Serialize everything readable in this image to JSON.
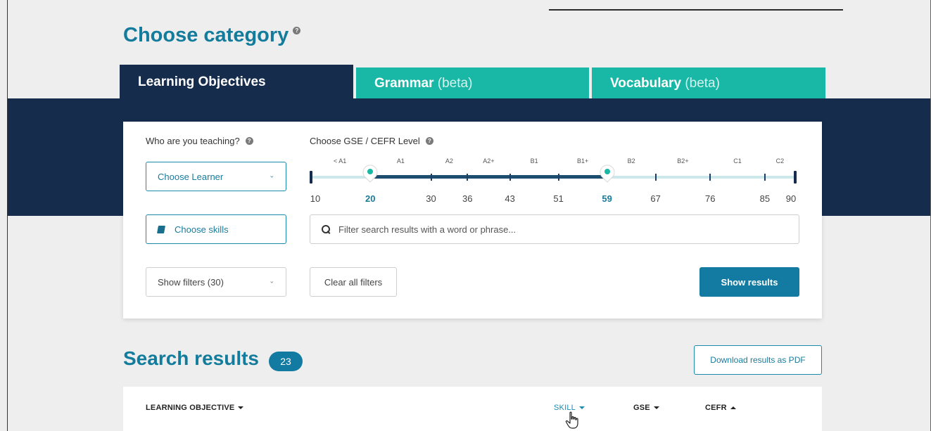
{
  "category": {
    "title": "Choose category",
    "help_icon": "question-circle-icon"
  },
  "tabs": [
    {
      "label": "Learning Objectives",
      "suffix": "",
      "active": true
    },
    {
      "label": "Grammar",
      "suffix": "(beta)",
      "active": false
    },
    {
      "label": "Vocabulary",
      "suffix": "(beta)",
      "active": false
    }
  ],
  "learner": {
    "label": "Who are you teaching?",
    "select_value": "Choose Learner"
  },
  "skills": {
    "button_label": "Choose skills",
    "icon": "book-icon"
  },
  "filters": {
    "select_value": "Show filters (30)",
    "clear_label": "Clear all filters"
  },
  "level": {
    "label": "Choose GSE / CEFR Level",
    "cefr_labels": [
      "< A1",
      "A1",
      "A2",
      "A2+",
      "B1",
      "B1+",
      "B2",
      "B2+",
      "C1",
      "C2"
    ],
    "gse_values": [
      "10",
      "20",
      "30",
      "36",
      "43",
      "51",
      "59",
      "67",
      "76",
      "85",
      "90"
    ],
    "min": 10,
    "max": 90,
    "selected_low": 20,
    "selected_high": 59
  },
  "search": {
    "placeholder": "Filter search results with a word or phrase...",
    "icon": "search-icon"
  },
  "show_results_label": "Show results",
  "results": {
    "title": "Search results",
    "count": "23",
    "download_label": "Download results as PDF"
  },
  "table": {
    "columns": [
      {
        "label": "LEARNING OBJECTIVE",
        "sort": "down",
        "active": false
      },
      {
        "label": "SKILL",
        "sort": "down",
        "active": true
      },
      {
        "label": "GSE",
        "sort": "down",
        "active": false
      },
      {
        "label": "CEFR",
        "sort": "up",
        "active": false
      }
    ]
  },
  "colors": {
    "navy": "#152c4c",
    "teal": "#19b7a5",
    "blue": "#137aa2",
    "title_blue": "#137c9c",
    "track": "#cde8ea"
  }
}
